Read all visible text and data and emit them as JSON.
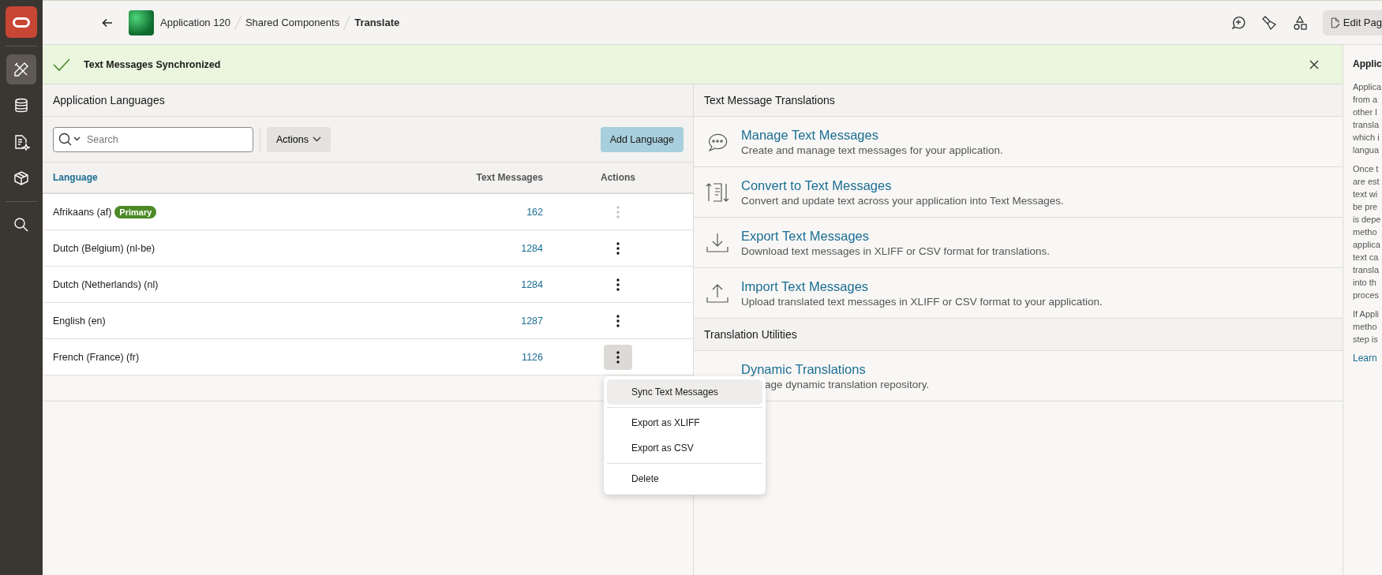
{
  "rail": {
    "items": [
      {
        "selected": true
      },
      {
        "selected": false
      },
      {
        "selected": false
      },
      {
        "selected": false
      },
      {
        "selected": false
      }
    ]
  },
  "breadcrumbs": [
    "Application 120",
    "Shared Components",
    "Translate"
  ],
  "edit_button": "Edit Pag",
  "banner": {
    "message": "Text Messages Synchronized"
  },
  "languages": {
    "title": "Application Languages",
    "search": {
      "placeholder": "Search"
    },
    "actions_button": "Actions",
    "add_button": "Add Language",
    "columns": [
      "Language",
      "Text Messages",
      "Actions"
    ],
    "rows": [
      {
        "language": "Afrikaans (af)",
        "badge": "Primary",
        "count": "162",
        "disabled": true,
        "menu_open": false
      },
      {
        "language": "Dutch (Belgium) (nl-be)",
        "count": "1284",
        "disabled": false,
        "menu_open": false
      },
      {
        "language": "Dutch (Netherlands) (nl)",
        "count": "1284",
        "disabled": false,
        "menu_open": false
      },
      {
        "language": "English (en)",
        "count": "1287",
        "disabled": false,
        "menu_open": false
      },
      {
        "language": "French (France) (fr)",
        "count": "1126",
        "disabled": false,
        "menu_open": true
      }
    ]
  },
  "row_menu": {
    "groups": [
      [
        {
          "label": "Sync Text Messages",
          "selected": true
        }
      ],
      [
        {
          "label": "Export as XLIFF",
          "selected": false
        },
        {
          "label": "Export as CSV",
          "selected": false
        }
      ],
      [
        {
          "label": "Delete",
          "selected": false
        }
      ]
    ]
  },
  "sections": [
    {
      "title": "Text Message Translations",
      "items": [
        {
          "title": "Manage Text Messages",
          "description": "Create and manage text messages for your application."
        },
        {
          "title": "Convert to Text Messages",
          "description": "Convert and update text across your application into Text Messages."
        },
        {
          "title": "Export Text Messages",
          "description": "Download text messages in XLIFF or CSV format for translations."
        },
        {
          "title": "Import Text Messages",
          "description": "Upload translated text messages in XLIFF or CSV format to your application."
        }
      ]
    },
    {
      "title": "Translation Utilities",
      "items": [
        {
          "title": "Dynamic Translations",
          "description": "age dynamic translation repository."
        }
      ]
    }
  ],
  "help": {
    "title": "Applic",
    "paragraphs": [
      [
        "Applica",
        "from a",
        "other l",
        "transla",
        "which i",
        "langua"
      ],
      [
        "Once t",
        "are est",
        "text wi",
        "be pre",
        "is depe",
        "metho",
        "applica",
        "text ca",
        "transla",
        "into th",
        "proces"
      ],
      [
        "If Appli",
        "metho",
        "step is"
      ]
    ],
    "link": "Learn"
  }
}
